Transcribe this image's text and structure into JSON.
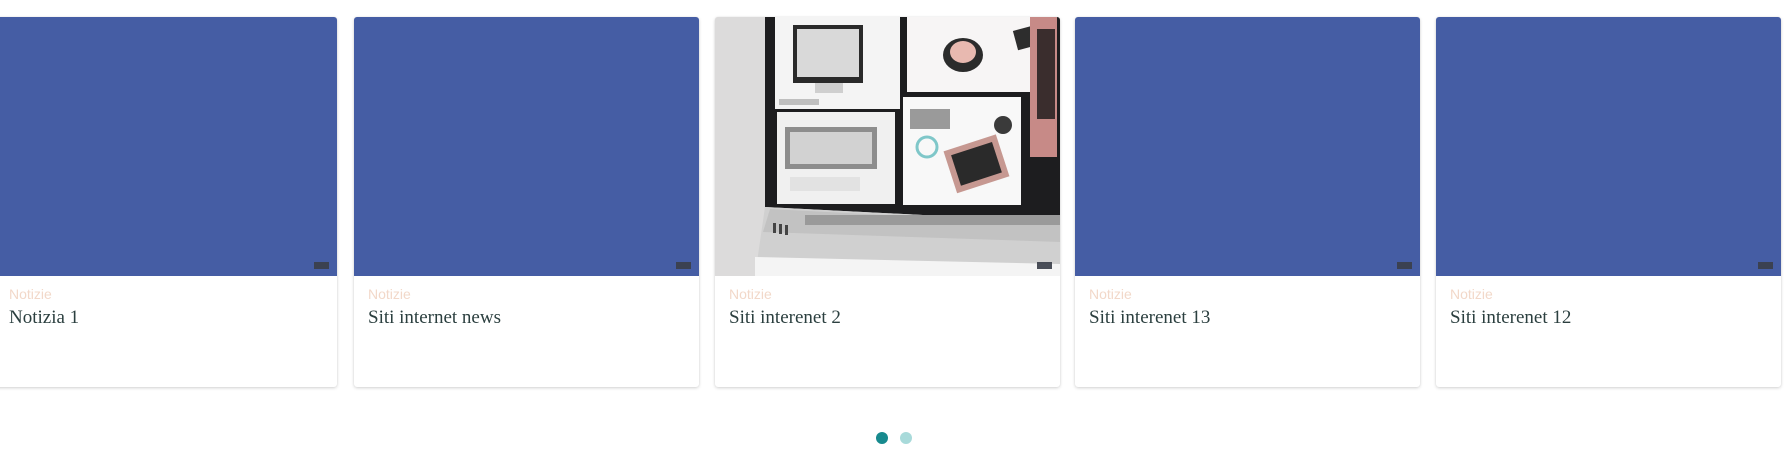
{
  "carousel": {
    "cards": [
      {
        "category": "Notizie",
        "title": "Notizia 1",
        "media": "blue-placeholder"
      },
      {
        "category": "Notizie",
        "title": "Siti internet news",
        "media": "blue-placeholder"
      },
      {
        "category": "Notizie",
        "title": "Siti interenet 2",
        "media": "laptop-photo"
      },
      {
        "category": "Notizie",
        "title": "Siti interenet 13",
        "media": "blue-placeholder"
      },
      {
        "category": "Notizie",
        "title": "Siti interenet 12",
        "media": "blue-placeholder"
      }
    ],
    "pagination": {
      "total": 2,
      "current": 1
    }
  },
  "colors": {
    "placeholder": "#455da4",
    "category": "#f2d8c9",
    "title": "#2b3f3f",
    "dot_active": "#178a8e",
    "dot_inactive": "#a8dada"
  }
}
